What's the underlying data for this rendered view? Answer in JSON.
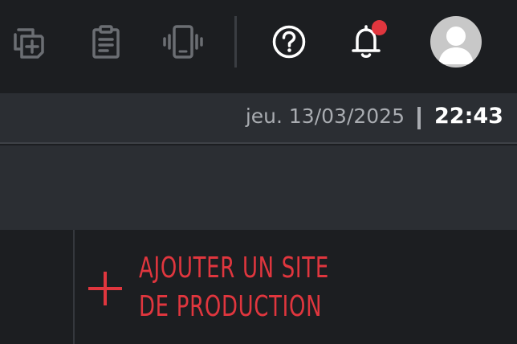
{
  "topbar": {
    "icons": [
      "add-documents-icon",
      "clipboard-icon",
      "vibrate-phone-icon",
      "help-icon",
      "bell-icon",
      "avatar-icon"
    ],
    "colors": {
      "dim_icon": "#6b6e73",
      "bright_icon": "#ffffff",
      "notification_dot": "#e0363e"
    }
  },
  "datebar": {
    "date": "jeu. 13/03/2025",
    "time": "22:43"
  },
  "main": {
    "add_site_label": "AJOUTER UN SITE DE PRODUCTION",
    "accent_color": "#e0363e"
  }
}
